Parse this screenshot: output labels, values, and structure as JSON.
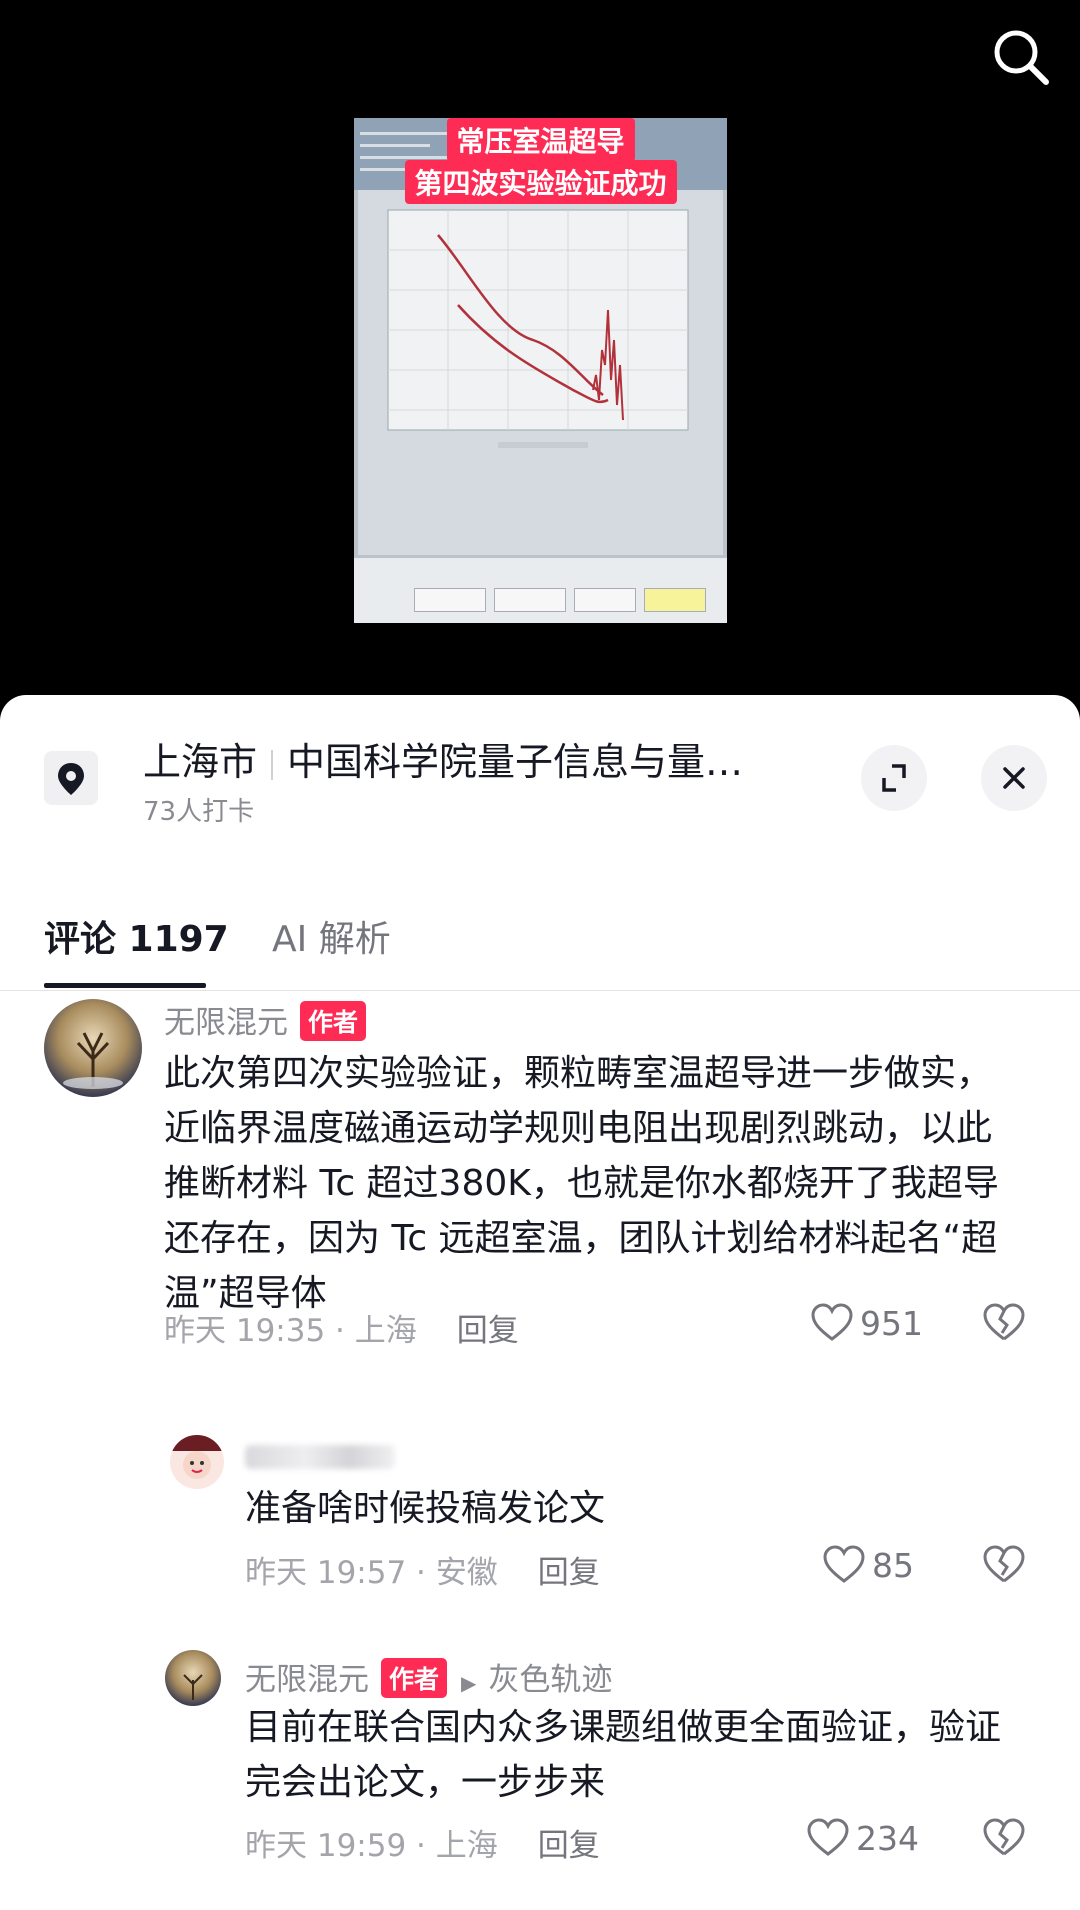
{
  "video": {
    "caption_line1": "常压室温超导",
    "caption_line2": "第四波实验验证成功",
    "icon": "search-icon"
  },
  "location": {
    "city": "上海市",
    "place": "中国科学院量子信息与量…",
    "checkins": "73人打卡",
    "icons": [
      "location-pin-icon",
      "expand-icon",
      "close-icon"
    ]
  },
  "tabs": {
    "comments": "评论 1197",
    "ai": "AI 解析"
  },
  "comments": [
    {
      "name": "无限混元",
      "badge": "作者",
      "text": "此次第四次实验验证，颗粒畴室温超导进一步做实，近临界温度磁通运动学规则电阻出现剧烈跳动，以此推断材料 Tc 超过380K，也就是你水都烧开了我超导还存在，因为 Tc 远超室温，团队计划给材料起名“超温”超导体",
      "time": "昨天 19:35 · 上海",
      "reply": "回复",
      "likes": "951"
    },
    {
      "name": "",
      "text": "准备啥时候投稿发论文",
      "time": "昨天 19:57 · 安徽",
      "reply": "回复",
      "likes": "85"
    },
    {
      "name": "无限混元",
      "badge": "作者",
      "reply_to": "灰色轨迹",
      "text": "目前在联合国内众多课题组做更全面验证，验证完会出论文，一步步来",
      "time": "昨天 19:59 · 上海",
      "reply": "回复",
      "likes": "234"
    }
  ]
}
